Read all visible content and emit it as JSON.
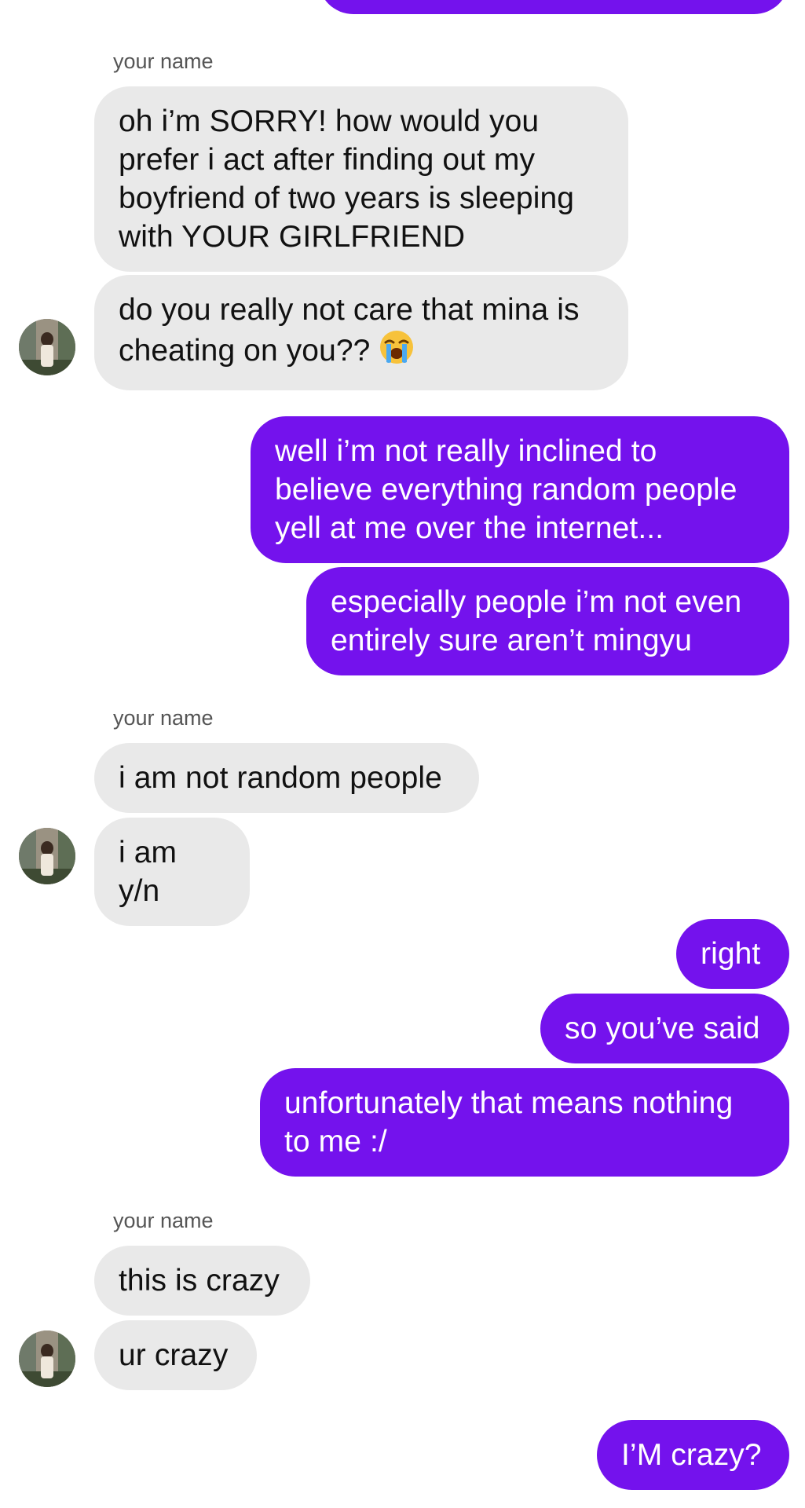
{
  "thread": {
    "messages": [
      {
        "id": "m1",
        "dir": "in",
        "text": "oh i’m SORRY! how would you\nprefer i act after finding out my\nboyfriend of two years is sleeping\nwith YOUR GIRLFRIEND"
      },
      {
        "id": "m2",
        "dir": "in",
        "text": "do you really not care that mina is\ncheating on you??",
        "emoji": "crying-face"
      },
      {
        "id": "m3",
        "dir": "out",
        "text": "well i’m not really inclined to\nbelieve everything random people\nyell at me over the internet..."
      },
      {
        "id": "m4",
        "dir": "out",
        "text": "especially people i’m not even\nentirely sure aren’t mingyu"
      },
      {
        "id": "m5",
        "dir": "in",
        "text": "i am not random people"
      },
      {
        "id": "m6",
        "dir": "in",
        "text": "i am y/n"
      },
      {
        "id": "m7",
        "dir": "out",
        "text": "right"
      },
      {
        "id": "m8",
        "dir": "out",
        "text": "so you’ve said"
      },
      {
        "id": "m9",
        "dir": "out",
        "text": "unfortunately that means nothing\nto me :/"
      },
      {
        "id": "m10",
        "dir": "in",
        "text": "this is crazy"
      },
      {
        "id": "m11",
        "dir": "in",
        "text": "ur crazy"
      },
      {
        "id": "m12",
        "dir": "out",
        "text": "I’M crazy?"
      }
    ],
    "sender_labels": [
      "your name",
      "your name",
      "your name"
    ]
  },
  "colors": {
    "outgoing_bubble": "#7412ed",
    "incoming_bubble": "#e9e9e9",
    "sender_label": "#555555"
  },
  "icons": {
    "emoji": "loudly-crying-face",
    "avatar": "contact-photo"
  }
}
